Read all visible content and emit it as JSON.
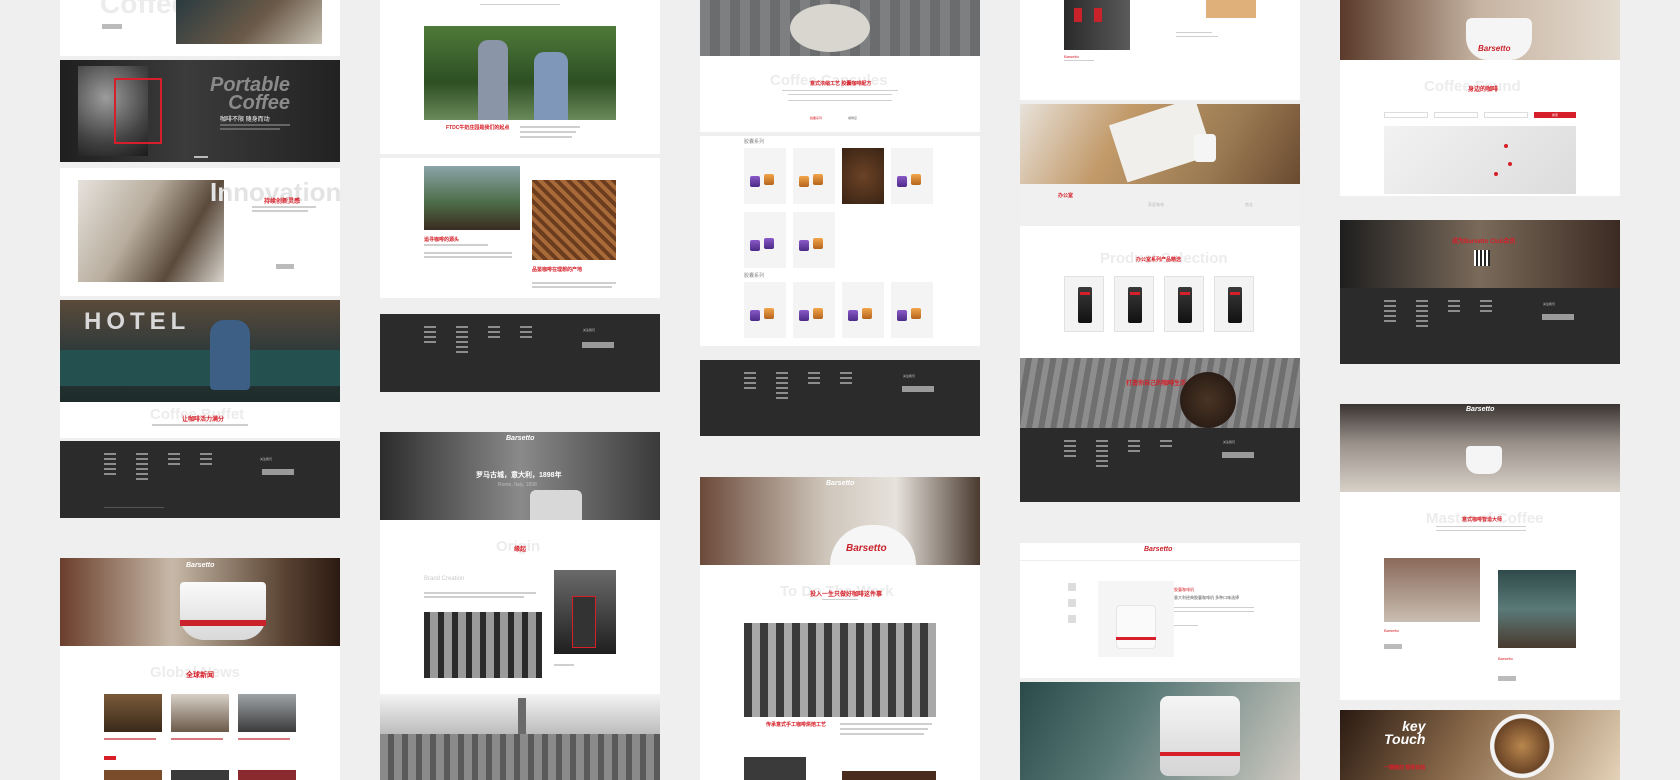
{
  "col1": {
    "ghost_top": "Coffee",
    "portable_title": "Portable\nCoffee",
    "portable_sub": "咖啡不限 随身而动",
    "innovation_ghost": "Innovation",
    "innovation_head": "持续创新灵感",
    "coffee_ghost": "Coffee Buffet",
    "coffee_head": "让咖啡活力满分",
    "news_ghost": "Global News",
    "news_head": "全球新闻",
    "brand": "Barsetto"
  },
  "col2": {
    "origin_head": "FTDC牛奶庄园是我们的起点",
    "farmer_head": "追寻咖啡的源头",
    "beans_head": "品鉴咖啡在理想的产地",
    "history_title": "罗马古城，意大利，1898年",
    "history_sub": "Rome, Italy, 1898",
    "origin_ghost": "Origin",
    "origin_ghost_head": "缘起",
    "brand_creation": "Brand Creation",
    "brand": "Barsetto"
  },
  "col3": {
    "capsules_ghost": "Coffee Capsules",
    "capsules_head": "意式浓缩工艺 胶囊咖啡配方",
    "tab1": "胶囊系列",
    "tab2": "咖啡豆",
    "group1": "胶囊系列",
    "group2": "胶囊系列",
    "work_ghost": "To Do The Work",
    "work_head": "投入一生只做好咖啡这件事",
    "history_caption": "传承意式手工咖啡烘焙工艺",
    "brand": "Barsetto"
  },
  "col4": {
    "office_label": "办公室",
    "tab_b": "家庭咖啡",
    "tab_c": "商业",
    "product_ghost": "Product Selection",
    "product_head": "办公室系列产品精选",
    "promo_head": "打造你自己的咖啡生活 办公室咖啡",
    "detail_head": "胶囊咖啡机",
    "detail_text": "意大利经典胶囊咖啡机 多种口味选择",
    "brand": "Barsetto"
  },
  "col5": {
    "found_ghost": "Coffee Found",
    "found_head": "身边的咖啡",
    "search_btn": "搜索",
    "club_head": "成为Barsetto Club会员",
    "master_ghost": "Master of Coffee",
    "master_head": "意式咖啡智造大师",
    "key_touch": "key\nTouch",
    "key_head": "一键触控 极致体验",
    "brand": "Barsetto"
  },
  "footer": {
    "colA": "关于我们",
    "colB": "咖啡机系列",
    "colC": "咖啡胶囊",
    "colD": "服务中心",
    "follow": "关注我们",
    "subscribe": "订阅"
  },
  "colors": {
    "accent": "#d61f28",
    "footer": "#2b2b2b",
    "bg": "#efefef"
  }
}
